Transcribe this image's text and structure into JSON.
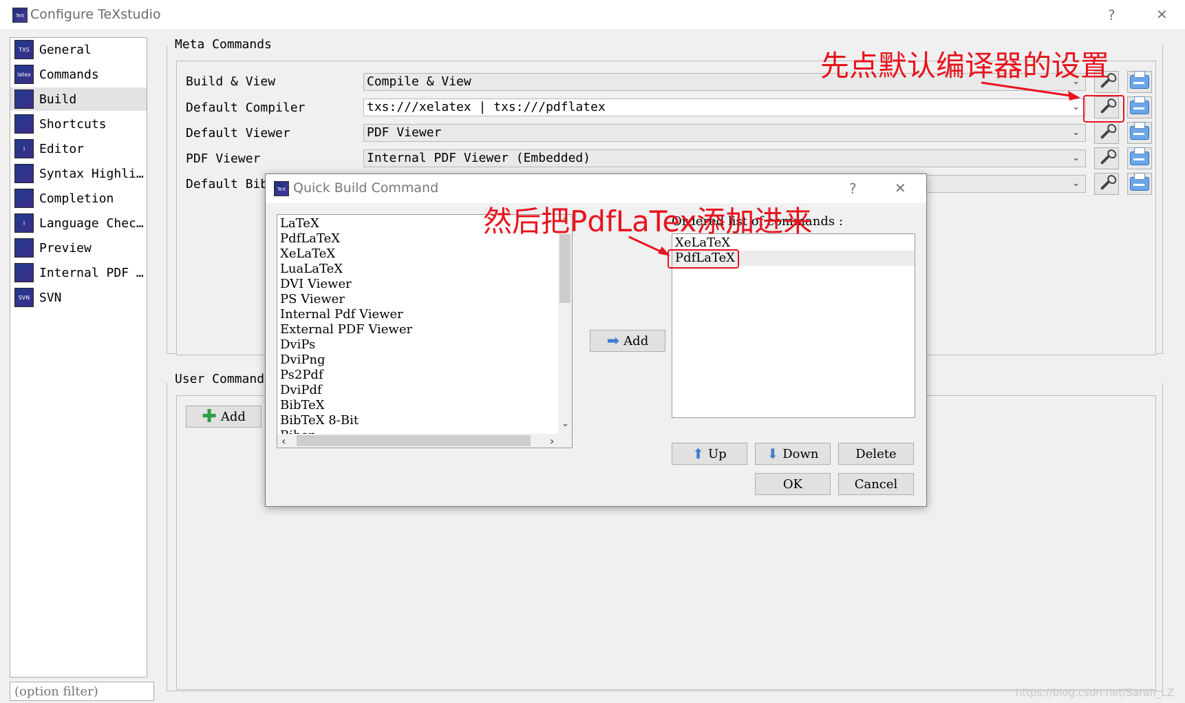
{
  "window": {
    "title": "Configure TeXstudio",
    "help_glyph": "?",
    "close_glyph": "✕",
    "icon_text": "TeX"
  },
  "sidebar": {
    "items": [
      {
        "label": "General",
        "icon": "txs-general-icon",
        "icon_text": "TXS"
      },
      {
        "label": "Commands",
        "icon": "latex-commands-icon",
        "icon_text": "latex"
      },
      {
        "label": "Build",
        "icon": "build-icon",
        "icon_text": ""
      },
      {
        "label": "Shortcuts",
        "icon": "keyboard-icon",
        "icon_text": ""
      },
      {
        "label": "Editor",
        "icon": "editor-icon",
        "icon_text": "I"
      },
      {
        "label": "Syntax Highli…",
        "icon": "syntax-icon",
        "icon_text": ""
      },
      {
        "label": "Completion",
        "icon": "completion-icon",
        "icon_text": ""
      },
      {
        "label": "Language Chec…",
        "icon": "language-icon",
        "icon_text": "I"
      },
      {
        "label": "Preview",
        "icon": "preview-icon",
        "icon_text": ""
      },
      {
        "label": "Internal PDF …",
        "icon": "pdf-icon",
        "icon_text": ""
      },
      {
        "label": "SVN",
        "icon": "svn-icon",
        "icon_text": "SVN"
      }
    ],
    "selected_index": 2,
    "filter_placeholder": "(option filter)"
  },
  "meta": {
    "title": "Meta Commands",
    "rows": [
      {
        "label": "Build & View",
        "value": "Compile & View"
      },
      {
        "label": "Default Compiler",
        "value": "txs:///xelatex | txs:///pdflatex"
      },
      {
        "label": "Default Viewer",
        "value": "PDF Viewer"
      },
      {
        "label": "PDF Viewer",
        "value": "Internal PDF Viewer (Embedded)"
      },
      {
        "label": "Default Bibl",
        "value": ""
      }
    ]
  },
  "user": {
    "title": "User Commands",
    "add_label": "Add"
  },
  "dialog": {
    "title": "Quick Build Command",
    "help_glyph": "?",
    "close_glyph": "✕",
    "available": [
      "LaTeX",
      "PdfLaTeX",
      "XeLaTeX",
      "LuaLaTeX",
      "DVI Viewer",
      "PS Viewer",
      "Internal Pdf Viewer",
      "External PDF Viewer",
      "DviPs",
      "DviPng",
      "Ps2Pdf",
      "DviPdf",
      "BibTeX",
      "BibTeX 8-Bit",
      "Biber"
    ],
    "add_label": "Add",
    "ordered_label": "Ordered list of commands :",
    "ordered": [
      "XeLaTeX",
      "PdfLaTeX"
    ],
    "up_label": "Up",
    "down_label": "Down",
    "delete_label": "Delete",
    "ok_label": "OK",
    "cancel_label": "Cancel"
  },
  "annotations": {
    "first": "先点默认编译器的设置",
    "second": "然后把PdfLaTex添加进来",
    "color": "#e8131d"
  },
  "watermark": "https://blog.csdn.net/Sarah_LZ"
}
